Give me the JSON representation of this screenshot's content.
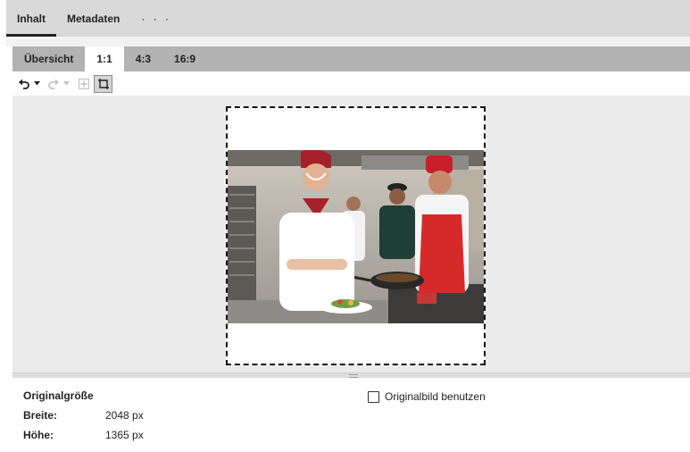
{
  "top_tabs": [
    "Inhalt",
    "Metadaten",
    "· · ·"
  ],
  "sub_tabs": [
    "Übersicht",
    "1:1",
    "4:3",
    "16:9"
  ],
  "active_sub_tab": "1:1",
  "toolbar": {
    "undo_icon": "undo-icon",
    "undo_dropdown_icon": "caret-down-icon",
    "redo_icon": "redo-icon",
    "redo_dropdown_icon": "caret-down-icon",
    "move_icon": "move-icon",
    "crop_icon": "crop-frame-icon"
  },
  "info": {
    "title": "Originalgröße",
    "width_label": "Breite:",
    "width_value": "2048 px",
    "height_label": "Höhe:",
    "height_value": "1365 px"
  },
  "use_original": {
    "label": "Originalbild benutzen",
    "checked": false
  },
  "colors": {
    "top_bar": "#d9d9d9",
    "sub_tab_bar": "#b3b3b3",
    "canvas_bg": "#ebebeb",
    "hat_red": "#a8202a",
    "apron_red": "#d62a2a"
  }
}
